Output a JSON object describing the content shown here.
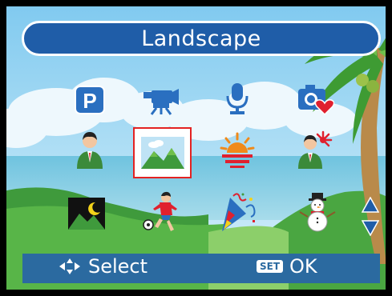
{
  "title": "Landscape",
  "selected_mode": "landscape",
  "modes": [
    {
      "id": "program",
      "icon": "program-p-icon"
    },
    {
      "id": "movie",
      "icon": "video-camera-icon"
    },
    {
      "id": "voice",
      "icon": "microphone-icon"
    },
    {
      "id": "favorite",
      "icon": "camera-heart-icon"
    },
    {
      "id": "portrait",
      "icon": "portrait-person-icon"
    },
    {
      "id": "landscape",
      "icon": "mountain-landscape-icon"
    },
    {
      "id": "sunset",
      "icon": "sunset-icon"
    },
    {
      "id": "backlight",
      "icon": "backlight-person-icon"
    },
    {
      "id": "night",
      "icon": "night-moon-icon"
    },
    {
      "id": "sports",
      "icon": "soccer-player-icon"
    },
    {
      "id": "party",
      "icon": "party-confetti-icon"
    },
    {
      "id": "snow",
      "icon": "snowman-icon"
    }
  ],
  "footer": {
    "select_label": "Select",
    "set_badge": "SET",
    "ok_label": "OK"
  },
  "colors": {
    "title_bar": "#1f5da8",
    "footer_bar": "#2b6aa0",
    "selection": "#e32222",
    "scroll_arrow": "#1f5da8"
  }
}
